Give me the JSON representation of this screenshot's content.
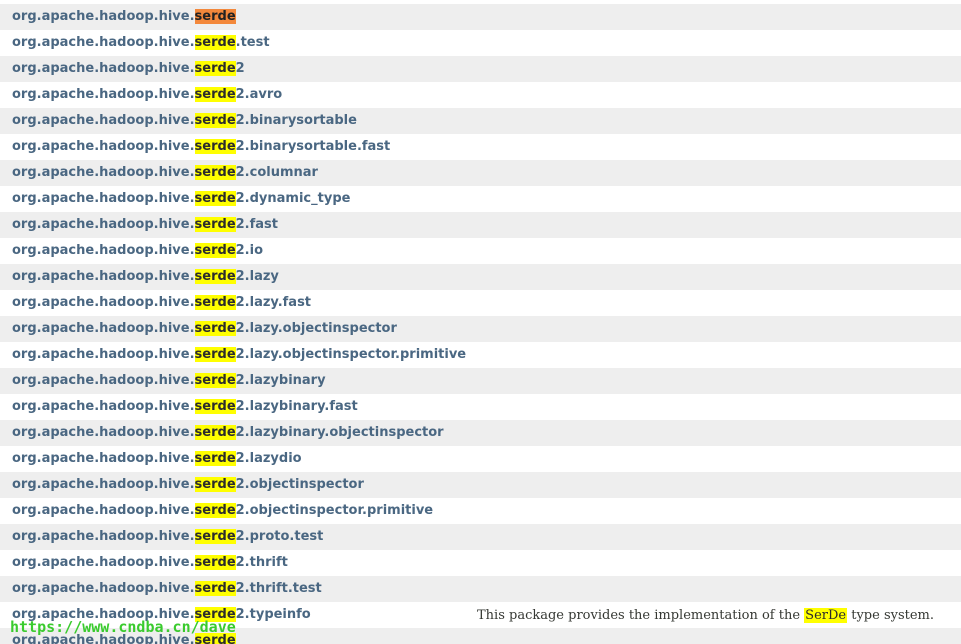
{
  "search": {
    "term": "serde",
    "prefix": "org.apache.hadoop.hive."
  },
  "packages": [
    {
      "suffix": "",
      "current": true
    },
    {
      "suffix": ".test"
    },
    {
      "suffix": "2"
    },
    {
      "suffix": "2.avro"
    },
    {
      "suffix": "2.binarysortable"
    },
    {
      "suffix": "2.binarysortable.fast"
    },
    {
      "suffix": "2.columnar"
    },
    {
      "suffix": "2.dynamic_type"
    },
    {
      "suffix": "2.fast"
    },
    {
      "suffix": "2.io"
    },
    {
      "suffix": "2.lazy"
    },
    {
      "suffix": "2.lazy.fast"
    },
    {
      "suffix": "2.lazy.objectinspector"
    },
    {
      "suffix": "2.lazy.objectinspector.primitive"
    },
    {
      "suffix": "2.lazybinary"
    },
    {
      "suffix": "2.lazybinary.fast"
    },
    {
      "suffix": "2.lazybinary.objectinspector"
    },
    {
      "suffix": "2.lazydio"
    },
    {
      "suffix": "2.objectinspector"
    },
    {
      "suffix": "2.objectinspector.primitive"
    },
    {
      "suffix": "2.proto.test"
    },
    {
      "suffix": "2.thrift"
    },
    {
      "suffix": "2.thrift.test"
    },
    {
      "suffix": "2.typeinfo",
      "description": {
        "before": "This package provides the implementation of the ",
        "term": "SerDe",
        "after": " type system."
      }
    },
    {
      "suffix": ""
    }
  ],
  "watermark": "https://www.cndba.cn/dave",
  "colors": {
    "highlight": "#ffff00",
    "current_highlight": "#f3883b",
    "link": "#4a6782",
    "shaded_row": "#eeeeee",
    "watermark": "#3acb2e"
  }
}
